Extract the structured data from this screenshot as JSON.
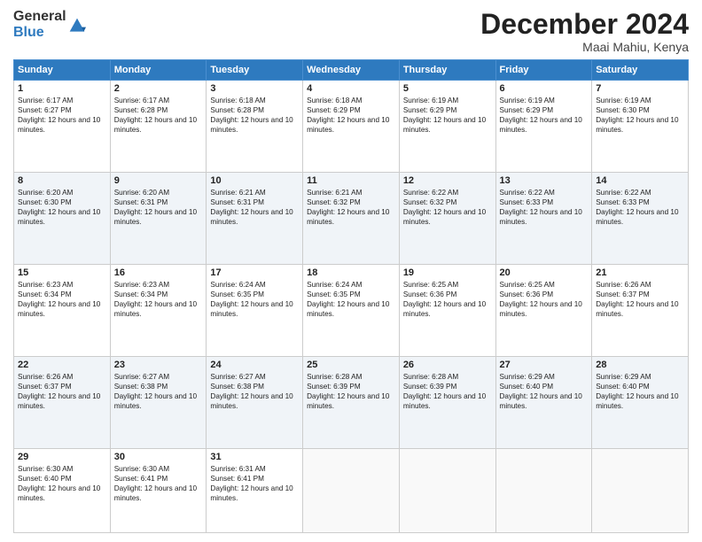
{
  "logo": {
    "general": "General",
    "blue": "Blue"
  },
  "title": "December 2024",
  "location": "Maai Mahiu, Kenya",
  "days_of_week": [
    "Sunday",
    "Monday",
    "Tuesday",
    "Wednesday",
    "Thursday",
    "Friday",
    "Saturday"
  ],
  "weeks": [
    [
      {
        "day": "1",
        "sunrise": "6:17 AM",
        "sunset": "6:27 PM",
        "daylight": "12 hours and 10 minutes."
      },
      {
        "day": "2",
        "sunrise": "6:17 AM",
        "sunset": "6:28 PM",
        "daylight": "12 hours and 10 minutes."
      },
      {
        "day": "3",
        "sunrise": "6:18 AM",
        "sunset": "6:28 PM",
        "daylight": "12 hours and 10 minutes."
      },
      {
        "day": "4",
        "sunrise": "6:18 AM",
        "sunset": "6:29 PM",
        "daylight": "12 hours and 10 minutes."
      },
      {
        "day": "5",
        "sunrise": "6:19 AM",
        "sunset": "6:29 PM",
        "daylight": "12 hours and 10 minutes."
      },
      {
        "day": "6",
        "sunrise": "6:19 AM",
        "sunset": "6:29 PM",
        "daylight": "12 hours and 10 minutes."
      },
      {
        "day": "7",
        "sunrise": "6:19 AM",
        "sunset": "6:30 PM",
        "daylight": "12 hours and 10 minutes."
      }
    ],
    [
      {
        "day": "8",
        "sunrise": "6:20 AM",
        "sunset": "6:30 PM",
        "daylight": "12 hours and 10 minutes."
      },
      {
        "day": "9",
        "sunrise": "6:20 AM",
        "sunset": "6:31 PM",
        "daylight": "12 hours and 10 minutes."
      },
      {
        "day": "10",
        "sunrise": "6:21 AM",
        "sunset": "6:31 PM",
        "daylight": "12 hours and 10 minutes."
      },
      {
        "day": "11",
        "sunrise": "6:21 AM",
        "sunset": "6:32 PM",
        "daylight": "12 hours and 10 minutes."
      },
      {
        "day": "12",
        "sunrise": "6:22 AM",
        "sunset": "6:32 PM",
        "daylight": "12 hours and 10 minutes."
      },
      {
        "day": "13",
        "sunrise": "6:22 AM",
        "sunset": "6:33 PM",
        "daylight": "12 hours and 10 minutes."
      },
      {
        "day": "14",
        "sunrise": "6:22 AM",
        "sunset": "6:33 PM",
        "daylight": "12 hours and 10 minutes."
      }
    ],
    [
      {
        "day": "15",
        "sunrise": "6:23 AM",
        "sunset": "6:34 PM",
        "daylight": "12 hours and 10 minutes."
      },
      {
        "day": "16",
        "sunrise": "6:23 AM",
        "sunset": "6:34 PM",
        "daylight": "12 hours and 10 minutes."
      },
      {
        "day": "17",
        "sunrise": "6:24 AM",
        "sunset": "6:35 PM",
        "daylight": "12 hours and 10 minutes."
      },
      {
        "day": "18",
        "sunrise": "6:24 AM",
        "sunset": "6:35 PM",
        "daylight": "12 hours and 10 minutes."
      },
      {
        "day": "19",
        "sunrise": "6:25 AM",
        "sunset": "6:36 PM",
        "daylight": "12 hours and 10 minutes."
      },
      {
        "day": "20",
        "sunrise": "6:25 AM",
        "sunset": "6:36 PM",
        "daylight": "12 hours and 10 minutes."
      },
      {
        "day": "21",
        "sunrise": "6:26 AM",
        "sunset": "6:37 PM",
        "daylight": "12 hours and 10 minutes."
      }
    ],
    [
      {
        "day": "22",
        "sunrise": "6:26 AM",
        "sunset": "6:37 PM",
        "daylight": "12 hours and 10 minutes."
      },
      {
        "day": "23",
        "sunrise": "6:27 AM",
        "sunset": "6:38 PM",
        "daylight": "12 hours and 10 minutes."
      },
      {
        "day": "24",
        "sunrise": "6:27 AM",
        "sunset": "6:38 PM",
        "daylight": "12 hours and 10 minutes."
      },
      {
        "day": "25",
        "sunrise": "6:28 AM",
        "sunset": "6:39 PM",
        "daylight": "12 hours and 10 minutes."
      },
      {
        "day": "26",
        "sunrise": "6:28 AM",
        "sunset": "6:39 PM",
        "daylight": "12 hours and 10 minutes."
      },
      {
        "day": "27",
        "sunrise": "6:29 AM",
        "sunset": "6:40 PM",
        "daylight": "12 hours and 10 minutes."
      },
      {
        "day": "28",
        "sunrise": "6:29 AM",
        "sunset": "6:40 PM",
        "daylight": "12 hours and 10 minutes."
      }
    ],
    [
      {
        "day": "29",
        "sunrise": "6:30 AM",
        "sunset": "6:40 PM",
        "daylight": "12 hours and 10 minutes."
      },
      {
        "day": "30",
        "sunrise": "6:30 AM",
        "sunset": "6:41 PM",
        "daylight": "12 hours and 10 minutes."
      },
      {
        "day": "31",
        "sunrise": "6:31 AM",
        "sunset": "6:41 PM",
        "daylight": "12 hours and 10 minutes."
      },
      null,
      null,
      null,
      null
    ]
  ],
  "labels": {
    "sunrise": "Sunrise:",
    "sunset": "Sunset:",
    "daylight": "Daylight:"
  }
}
